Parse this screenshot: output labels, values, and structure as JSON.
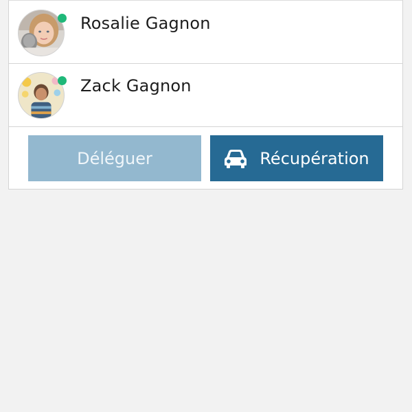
{
  "contacts": [
    {
      "name": "Rosalie Gagnon",
      "status": "online",
      "avatar_icon": "child-photo-avatar",
      "status_color": "#1fb879"
    },
    {
      "name": "Zack Gagnon",
      "status": "online",
      "avatar_icon": "child-photo-avatar",
      "status_color": "#1fb879"
    }
  ],
  "actions": {
    "delegate_label": "Déléguer",
    "pickup_label": "Récupération",
    "pickup_icon": "car-icon"
  },
  "colors": {
    "delegate_button": "#93b8cf",
    "pickup_button": "#266a94",
    "status_online": "#1fb879",
    "background": "#f2f2f2"
  }
}
